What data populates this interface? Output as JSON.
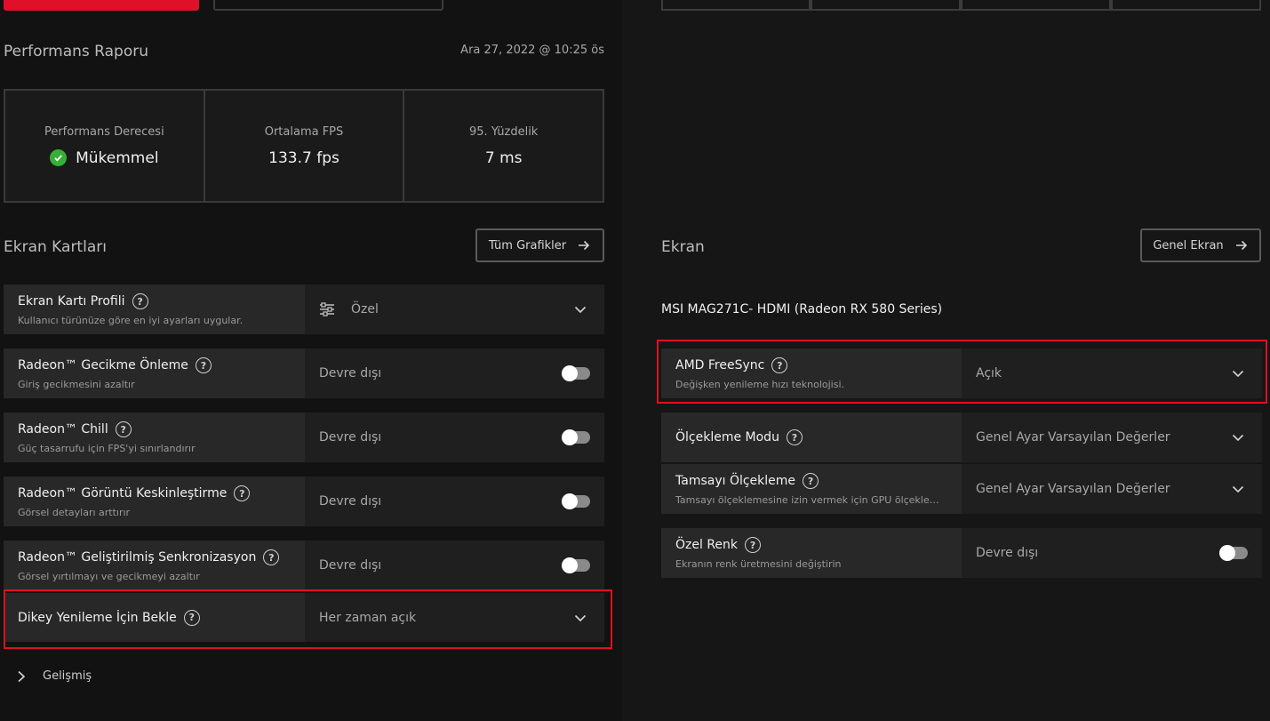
{
  "report": {
    "title": "Performans Raporu",
    "timestamp": "Ara 27, 2022 @ 10:25 ös",
    "metrics": [
      {
        "label": "Performans Derecesi",
        "value": "Mükemmel",
        "icon": "check-circle-icon"
      },
      {
        "label": "Ortalama FPS",
        "value": "133.7 fps"
      },
      {
        "label": "95. Yüzdelik",
        "value": "7 ms"
      }
    ]
  },
  "gpu": {
    "section_title": "Ekran Kartları",
    "all_graphics_button": "Tüm Grafikler",
    "settings": [
      {
        "title": "Ekran Kartı Profili",
        "subtitle": "Kullanıcı türünüze göre en iyi ayarları uygular.",
        "value": "Özel",
        "control": "dropdown"
      },
      {
        "title": "Radeon™ Gecikme Önleme",
        "subtitle": "Giriş gecikmesini azaltır",
        "value": "Devre dışı",
        "control": "toggle"
      },
      {
        "title": "Radeon™ Chill",
        "subtitle": "Güç tasarrufu için FPS'yi sınırlandırır",
        "value": "Devre dışı",
        "control": "toggle"
      },
      {
        "title": "Radeon™ Görüntü Keskinleştirme",
        "subtitle": "Görsel detayları arttırır",
        "value": "Devre dışı",
        "control": "toggle"
      },
      {
        "title": "Radeon™ Geliştirilmiş Senkronizasyon",
        "subtitle": "Görsel yırtılmayı ve gecikmeyi azaltır",
        "value": "Devre dışı",
        "control": "toggle"
      },
      {
        "title": "Dikey Yenileme İçin Bekle",
        "subtitle": "",
        "value": "Her zaman açık",
        "control": "dropdown"
      }
    ],
    "advanced_label": "Gelişmiş"
  },
  "display": {
    "section_title": "Ekran",
    "general_button": "Genel Ekran",
    "monitor_name": "MSI MAG271C- HDMI (Radeon RX 580 Series)",
    "settings": [
      {
        "title": "AMD FreeSync",
        "subtitle": "Değişken yenileme hızı teknolojisi.",
        "value": "Açık",
        "control": "dropdown"
      },
      {
        "title": "Ölçekleme Modu",
        "subtitle": "",
        "value": "Genel Ayar Varsayılan Değerler",
        "control": "dropdown"
      },
      {
        "title": "Tamsayı Ölçekleme",
        "subtitle": "Tamsayı ölçeklemesine izin vermek için GPU ölçeklemeyi ...",
        "value": "Genel Ayar Varsayılan Değerler",
        "control": "dropdown"
      },
      {
        "title": "Özel Renk",
        "subtitle": "Ekranın renk üretmesini değiştirin",
        "value": "Devre dışı",
        "control": "toggle"
      }
    ]
  },
  "colors": {
    "accent": "#e0102a",
    "highlight": "#e0101e",
    "success": "#35b035"
  }
}
